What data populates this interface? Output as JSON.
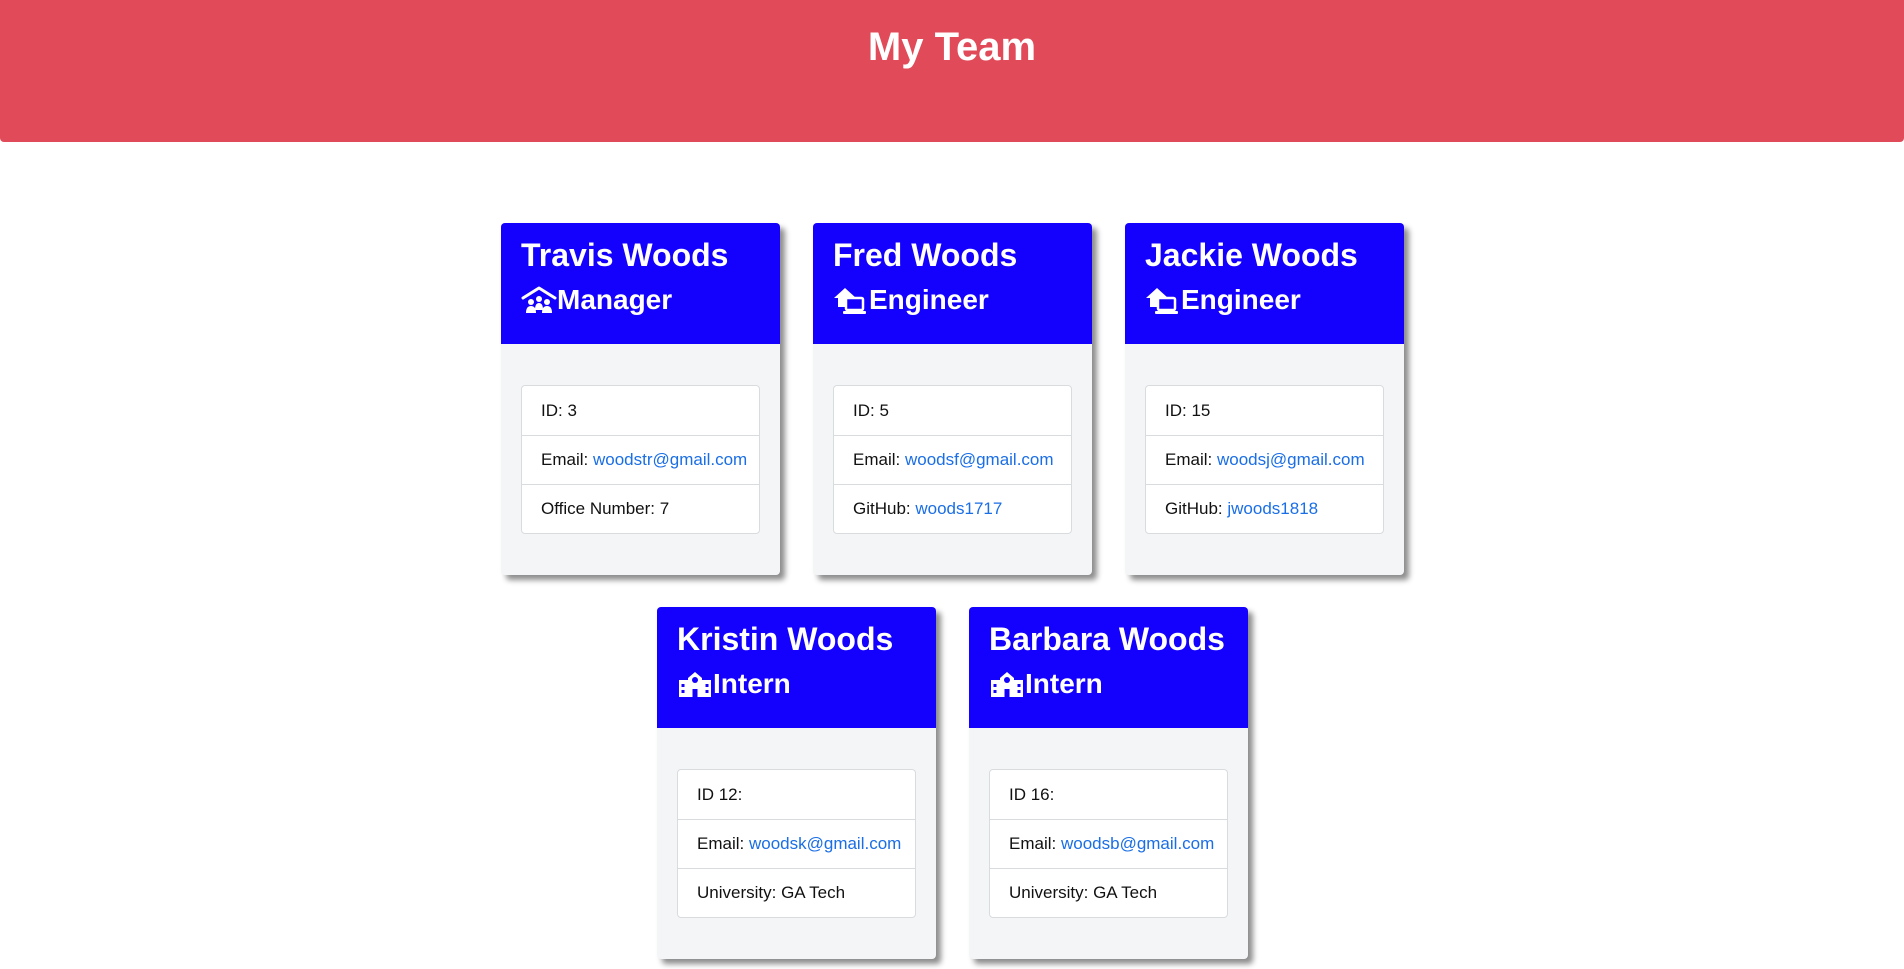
{
  "header": {
    "title": "My Team"
  },
  "colors": {
    "header_bg": "#e14b59",
    "card_header_bg": "#1400fd",
    "link": "#1a6ee6"
  },
  "team": [
    {
      "name": "Travis Woods",
      "role": "Manager",
      "icon": "manager-icon",
      "id_text": "ID: 3",
      "email_label": "Email:",
      "email": "woodstr@gmail.com",
      "extra_label": "Office Number: 7",
      "extra_link": ""
    },
    {
      "name": "Fred Woods",
      "role": "Engineer",
      "icon": "engineer-icon",
      "id_text": "ID: 5",
      "email_label": "Email:",
      "email": "woodsf@gmail.com",
      "extra_label": "GitHub:",
      "extra_link": "woods1717"
    },
    {
      "name": "Jackie Woods",
      "role": "Engineer",
      "icon": "engineer-icon",
      "id_text": "ID: 15",
      "email_label": "Email:",
      "email": "woodsj@gmail.com",
      "extra_label": "GitHub:",
      "extra_link": "jwoods1818"
    },
    {
      "name": "Kristin Woods",
      "role": "Intern",
      "icon": "school-icon",
      "id_text": "ID 12:",
      "email_label": "Email:",
      "email": "woodsk@gmail.com",
      "extra_label": "University: GA Tech",
      "extra_link": ""
    },
    {
      "name": "Barbara Woods",
      "role": "Intern",
      "icon": "school-icon",
      "id_text": "ID 16:",
      "email_label": "Email:",
      "email": "woodsb@gmail.com",
      "extra_label": "University: GA Tech",
      "extra_link": ""
    }
  ]
}
